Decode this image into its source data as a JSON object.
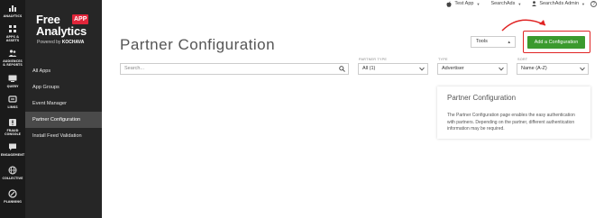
{
  "rail": {
    "items": [
      {
        "label": "ANALYTICS",
        "icon": "chart-icon"
      },
      {
        "label": "APPS & ASSETS",
        "icon": "apps-grid-icon"
      },
      {
        "label": "AUDIENCES & REPORTS",
        "icon": "people-icon"
      },
      {
        "label": "QUERY",
        "icon": "query-icon"
      },
      {
        "label": "LINKS",
        "icon": "link-icon"
      },
      {
        "label": "FRAUD CONSOLE",
        "icon": "fraud-icon"
      },
      {
        "label": "ENGAGEMENT",
        "icon": "chat-icon"
      },
      {
        "label": "COLLECTIVE",
        "icon": "globe-icon"
      },
      {
        "label": "PLANNING",
        "icon": "planning-icon"
      }
    ]
  },
  "brand": {
    "free": "Free",
    "analytics": "Analytics",
    "app_badge": "APP",
    "powered_by": "Powered by",
    "company": "KOCHAVA"
  },
  "sidebar": {
    "items": [
      {
        "label": "All Apps",
        "active": false
      },
      {
        "label": "App Groups",
        "active": false
      },
      {
        "label": "Event Manager",
        "active": false
      },
      {
        "label": "Partner Configuration",
        "active": true
      },
      {
        "label": "Install Feed Validation",
        "active": false
      }
    ]
  },
  "topbar": {
    "app_label": "Test App",
    "search_ads_label": "SearchAds",
    "user_label": "SearchAds Admin",
    "help_label": "?"
  },
  "page": {
    "title": "Partner Configuration"
  },
  "toolbar": {
    "tools_label": "Tools",
    "add_button_label": "Add a Configuration"
  },
  "search": {
    "placeholder": "Search..."
  },
  "filters": [
    {
      "label": "PARTNER TYPE",
      "value": "All (1)"
    },
    {
      "label": "TYPE",
      "value": "Advertiser"
    },
    {
      "label": "SORT",
      "value": "Name (A-Z)"
    }
  ],
  "info_panel": {
    "title": "Partner Configuration",
    "text": "The Partner Configuration page enables the easy authentication with partners. Depending on the partner, different authentication information may be required."
  },
  "colors": {
    "rail_bg": "#1a1a1a",
    "sidebar_bg": "#262626",
    "active_item_bg": "#4a4a4a",
    "primary_button": "#3b9a2e",
    "highlight": "#e02424",
    "brand_red": "#e1253a"
  }
}
